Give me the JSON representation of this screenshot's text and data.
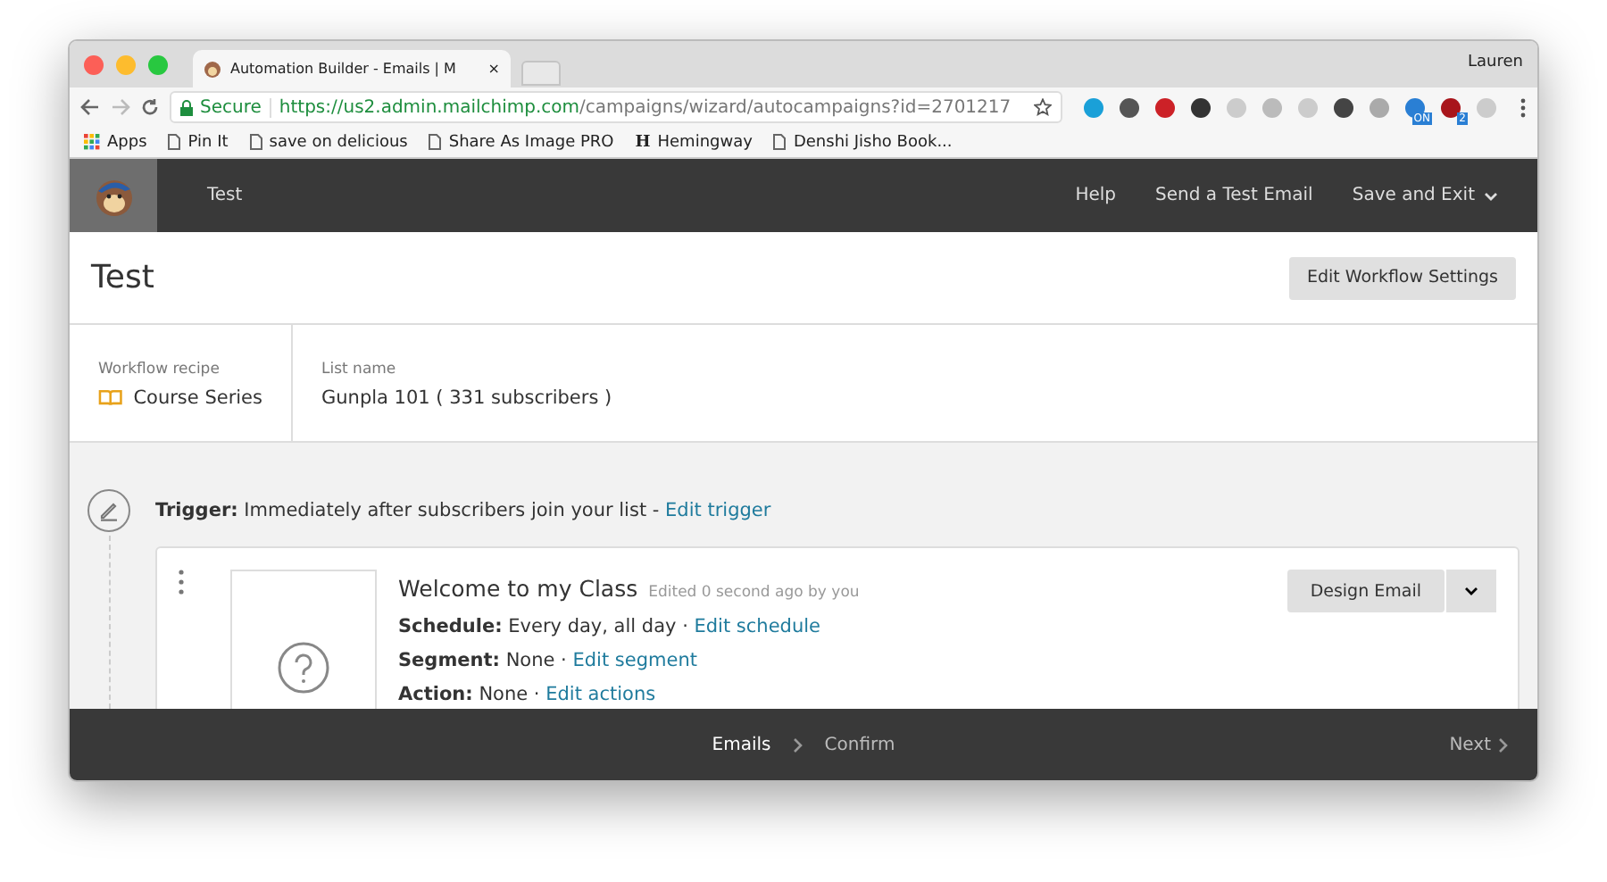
{
  "browser": {
    "tab_title": "Automation Builder - Emails | M",
    "close": "×",
    "user": "Lauren",
    "secure_label": "Secure",
    "url_host": "https://us2.admin.mailchimp.com",
    "url_path": "/campaigns/wizard/autocampaigns?id=2701217",
    "extensions": [
      {
        "color": "#1aa0d8"
      },
      {
        "color": "#555555"
      },
      {
        "color": "#cc2127"
      },
      {
        "color": "#333333"
      },
      {
        "color": "#cccccc"
      },
      {
        "color": "#bbbbbb"
      },
      {
        "color": "#cccccc"
      },
      {
        "color": "#444444"
      },
      {
        "color": "#aaaaaa"
      },
      {
        "color": "#2a7fd4",
        "badge": "ON"
      },
      {
        "color": "#a8151b",
        "badge": "2"
      },
      {
        "color": "#cccccc"
      }
    ],
    "bookmarks": [
      {
        "label": "Apps",
        "kind": "apps"
      },
      {
        "label": "Pin It",
        "kind": "page"
      },
      {
        "label": "save on delicious",
        "kind": "page"
      },
      {
        "label": "Share As Image PRO",
        "kind": "page"
      },
      {
        "label": "Hemingway",
        "kind": "letter",
        "glyph": "H"
      },
      {
        "label": "Denshi Jisho Book...",
        "kind": "page"
      }
    ]
  },
  "nav": {
    "title": "Test",
    "links": [
      {
        "label": "Help",
        "dropdown": false
      },
      {
        "label": "Send a Test Email",
        "dropdown": false
      },
      {
        "label": "Save and Exit",
        "dropdown": true
      }
    ]
  },
  "header": {
    "title": "Test",
    "button": "Edit Workflow Settings"
  },
  "info": [
    {
      "label": "Workflow recipe",
      "value": "Course Series",
      "icon": true
    },
    {
      "label": "List name",
      "value": "Gunpla 101 ( 331 subscribers )"
    }
  ],
  "trigger": {
    "label": "Trigger:",
    "text": "Immediately after subscribers join your list -",
    "link": "Edit trigger"
  },
  "email": {
    "title": "Welcome to my Class",
    "edited": "Edited 0 second ago by you",
    "button": "Design Email",
    "rows": [
      {
        "label": "Schedule:",
        "value": "Every day, all day ·",
        "link": "Edit schedule"
      },
      {
        "label": "Segment:",
        "value": "None ·",
        "link": "Edit segment"
      },
      {
        "label": "Action:",
        "value": "None ·",
        "link": "Edit actions"
      }
    ]
  },
  "footer": {
    "steps": [
      {
        "label": "Emails",
        "selected": true
      },
      {
        "label": "Confirm",
        "selected": false
      }
    ],
    "next": "Next"
  }
}
